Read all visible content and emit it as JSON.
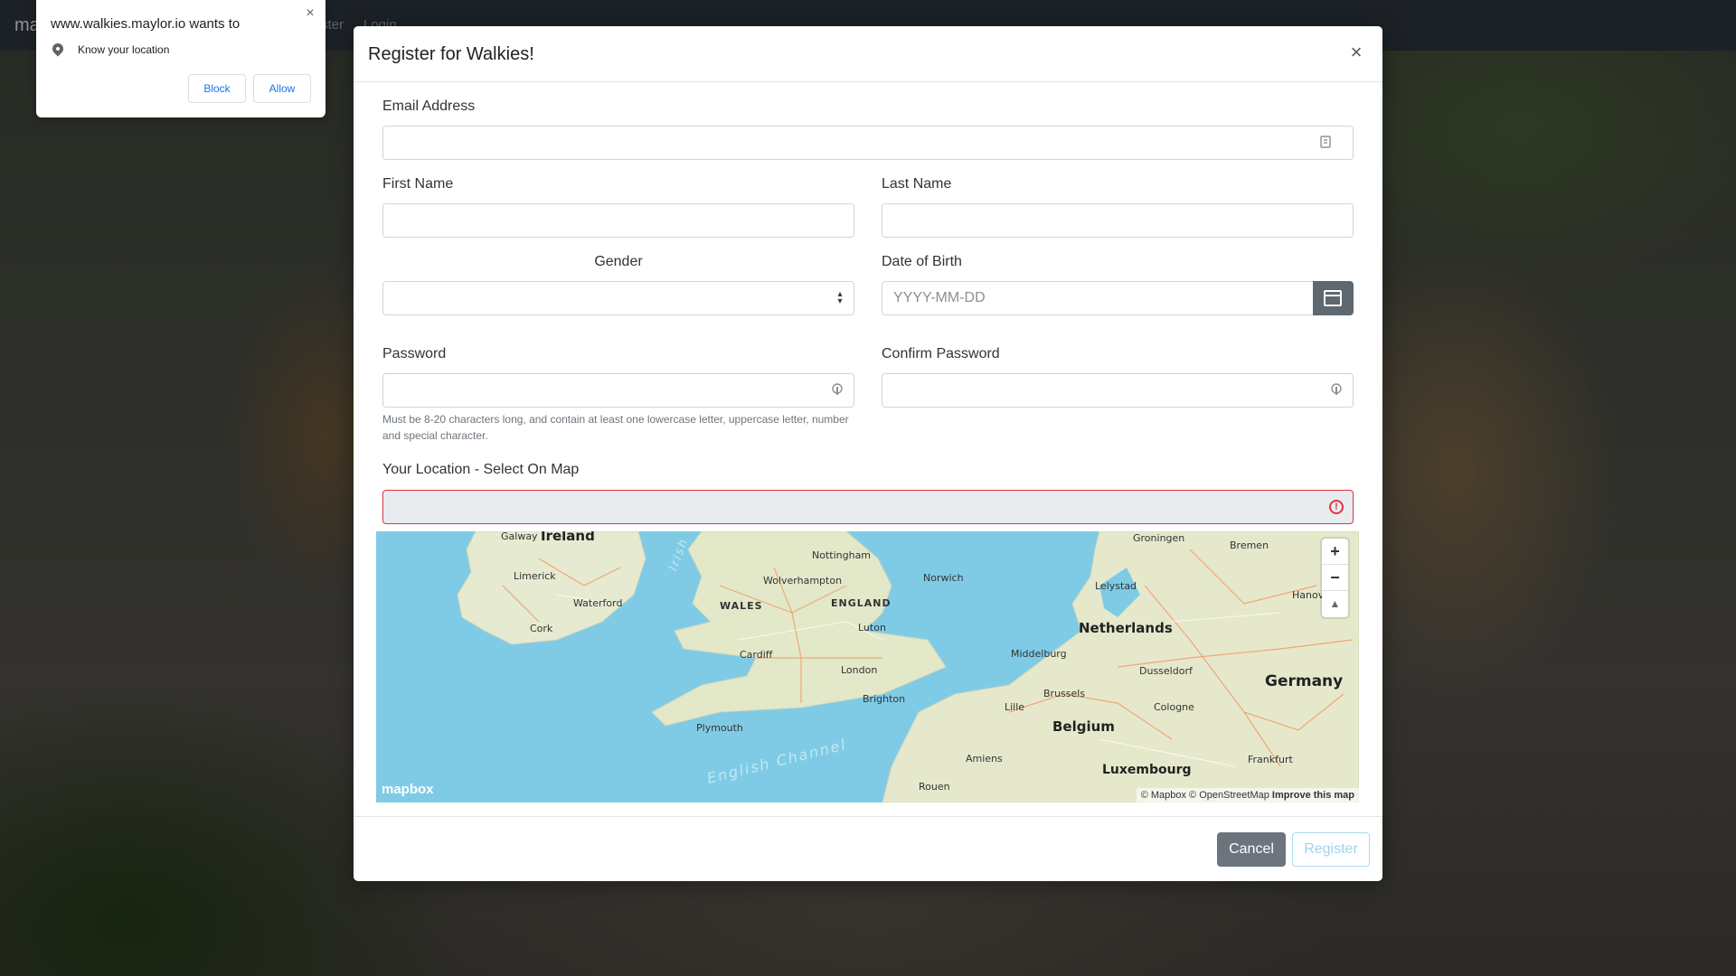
{
  "navbar": {
    "brand": "ma",
    "nav_items": [
      "ster",
      "Login"
    ]
  },
  "permission_prompt": {
    "title": "www.walkies.maylor.io wants to",
    "item": "Know your location",
    "block_label": "Block",
    "allow_label": "Allow",
    "close_label": "×"
  },
  "modal": {
    "title": "Register for Walkies!",
    "close_label": "×",
    "fields": {
      "email": {
        "label": "Email Address",
        "value": ""
      },
      "first_name": {
        "label": "First Name",
        "value": ""
      },
      "last_name": {
        "label": "Last Name",
        "value": ""
      },
      "gender": {
        "label": "Gender",
        "value": ""
      },
      "dob": {
        "label": "Date of Birth",
        "placeholder": "YYYY-MM-DD"
      },
      "password": {
        "label": "Password",
        "value": "",
        "help": "Must be 8-20 characters long, and contain at least one lowercase letter, uppercase letter, number and special character."
      },
      "confirm_password": {
        "label": "Confirm Password",
        "value": ""
      },
      "location": {
        "label": "Your Location - Select On Map",
        "value": "",
        "state": "invalid"
      }
    },
    "map": {
      "labels": {
        "galway": "Galway",
        "ireland": "Ireland",
        "irish_sea": "Irish",
        "limerick": "Limerick",
        "waterford": "Waterford",
        "cork": "Cork",
        "nottingham": "Nottingham",
        "wolverhampton": "Wolverhampton",
        "norwich": "Norwich",
        "wales": "WALES",
        "england": "ENGLAND",
        "luton": "Luton",
        "cardiff": "Cardiff",
        "london": "London",
        "brighton": "Brighton",
        "plymouth": "Plymouth",
        "english_channel": "English Channel",
        "groningen": "Groningen",
        "bremen": "Bremen",
        "lelystad": "Lelystad",
        "hanover": "Hanover",
        "netherlands": "Netherlands",
        "middelburg": "Middelburg",
        "dusseldorf": "Dusseldorf",
        "germany": "Germany",
        "brussels": "Brussels",
        "lille": "Lille",
        "cologne": "Cologne",
        "belgium": "Belgium",
        "amiens": "Amiens",
        "luxembourg": "Luxembourg",
        "frankfurt": "Frankfurt",
        "rouen": "Rouen"
      },
      "zoom_in": "+",
      "zoom_out": "−",
      "compass": "▲",
      "logo": "mapbox",
      "attribution": "© Mapbox © OpenStreetMap",
      "improve": "Improve this map"
    },
    "footer": {
      "cancel_label": "Cancel",
      "register_label": "Register"
    }
  }
}
